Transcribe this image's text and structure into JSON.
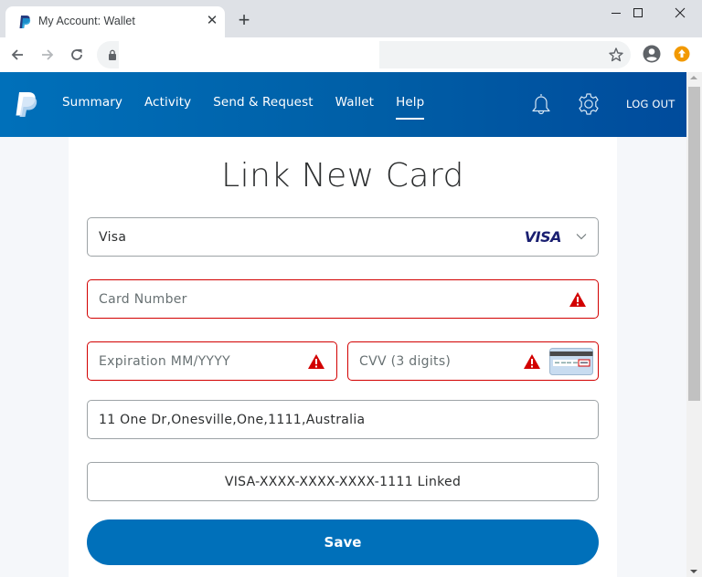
{
  "browser": {
    "tab_title": "My Account: Wallet",
    "tab_close_glyph": "✕",
    "new_tab_glyph": "+",
    "icons": [
      "paypal-favicon",
      "close-icon",
      "plus-icon",
      "minimize-icon",
      "maximize-icon",
      "window-close-icon",
      "back-arrow-icon",
      "forward-arrow-icon",
      "reload-icon",
      "lock-icon",
      "star-icon",
      "profile-icon",
      "update-icon"
    ],
    "update_color": "#f29900"
  },
  "header": {
    "nav": [
      {
        "label": "Summary"
      },
      {
        "label": "Activity"
      },
      {
        "label": "Send & Request"
      },
      {
        "label": "Wallet"
      },
      {
        "label": "Help",
        "active": true
      }
    ],
    "logout_label": "LOG OUT",
    "icons": [
      "paypal-logo",
      "bell-icon",
      "gear-icon"
    ],
    "brand_color": "#0070ba"
  },
  "form": {
    "title": "Link New Card",
    "card_type": {
      "value": "Visa",
      "brand_label": "VISA"
    },
    "card_number": {
      "placeholder": "Card Number",
      "error": true
    },
    "expiration": {
      "placeholder": "Expiration MM/YYYY",
      "error": true
    },
    "cvv": {
      "placeholder": "CVV (3 digits)",
      "error": true
    },
    "billing_address": {
      "value": "11 One Dr,Onesville,One,1111,Australia"
    },
    "linked_status": "VISA-XXXX-XXXX-XXXX-1111 Linked",
    "save_label": "Save",
    "error_color": "#d20000"
  }
}
